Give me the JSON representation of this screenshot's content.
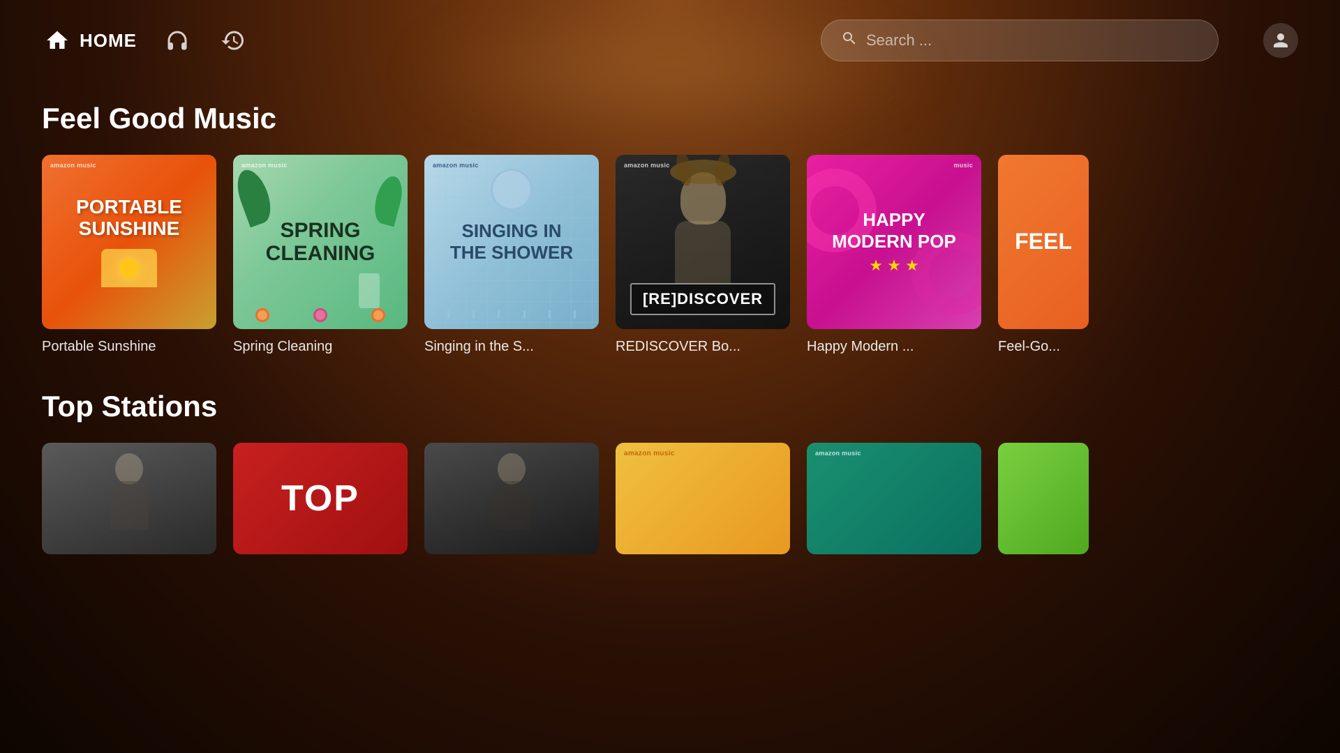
{
  "app": {
    "title": "Amazon Music"
  },
  "header": {
    "home_label": "HOME",
    "search_placeholder": "Search ..."
  },
  "feel_good_section": {
    "title": "Feel Good Music",
    "cards": [
      {
        "id": "portable-sunshine",
        "title": "Portable Sunshine",
        "display_title": "Portable Sunshine",
        "art_line1": "PORTABLE",
        "art_line2": "SUNSHINE",
        "badge": "amazon music"
      },
      {
        "id": "spring-cleaning",
        "title": "Spring Cleaning",
        "display_title": "Spring Cleaning",
        "art_line1": "SPRING",
        "art_line2": "CLEANING",
        "badge": "amazon music"
      },
      {
        "id": "singing-shower",
        "title": "Singing in the S...",
        "display_title": "Singing in the S...",
        "art_line1": "SINGING IN",
        "art_line2": "THE SHOWER",
        "badge": "amazon music"
      },
      {
        "id": "rediscover",
        "title": "REDISCOVER Bo...",
        "display_title": "REDISCOVER Bo...",
        "art_text": "[RE]DISCOVER",
        "badge": "amazon music"
      },
      {
        "id": "happy-modern-pop",
        "title": "Happy Modern ...",
        "display_title": "Happy Modern ...",
        "art_line1": "HAPPY",
        "art_line2": "MODERN POP",
        "art_stars": "★ ★ ★",
        "badge": "music"
      },
      {
        "id": "feel-good-country",
        "title": "Feel-Go...",
        "display_title": "Feel-Go...",
        "art_text": "FEEL",
        "badge": ""
      }
    ]
  },
  "top_stations_section": {
    "title": "Top Stations",
    "cards": [
      {
        "id": "bc1",
        "label": ""
      },
      {
        "id": "bc2",
        "label": "TOP"
      },
      {
        "id": "bc3",
        "label": ""
      },
      {
        "id": "bc4",
        "label": ""
      },
      {
        "id": "bc5",
        "label": "",
        "badge": "amazon music"
      },
      {
        "id": "bc6",
        "label": ""
      }
    ]
  }
}
